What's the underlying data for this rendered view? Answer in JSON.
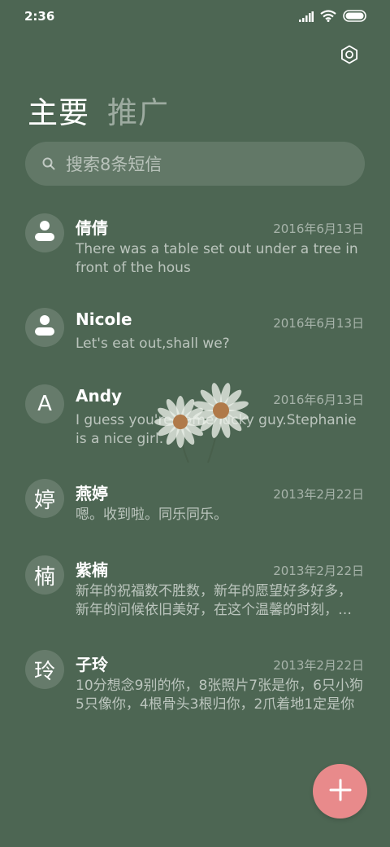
{
  "status": {
    "time": "2:36"
  },
  "tabs": [
    {
      "label": "主要"
    },
    {
      "label": "推广"
    }
  ],
  "search": {
    "placeholder": "搜索8条短信"
  },
  "messages": [
    {
      "avatar": "",
      "avatar_icon": "person-icon",
      "name": "倩倩",
      "date": "2016年6月13日",
      "preview": "There was a table set out under a tree in front of the hous"
    },
    {
      "avatar": "",
      "avatar_icon": "person-icon",
      "name": "Nicole",
      "date": "2016年6月13日",
      "preview": "Let's eat out,shall we?"
    },
    {
      "avatar": "A",
      "name": "Andy",
      "date": "2016年6月13日",
      "preview": "I guess you're some lucky guy.Stephanie is a nice girl."
    },
    {
      "avatar": "婷",
      "name": "燕婷",
      "date": "2013年2月22日",
      "preview": "嗯。收到啦。同乐同乐。"
    },
    {
      "avatar": "楠",
      "name": "紫楠",
      "date": "2013年2月22日",
      "preview": "新年的祝福数不胜数，新年的愿望好多好多，新年的问候依旧美好，在这个温馨的时刻，送上我最真诚的祝福"
    },
    {
      "avatar": "玲",
      "name": "子玲",
      "date": "2013年2月22日",
      "preview": "10分想念9别的你，8张照片7张是你，6只小狗5只像你，4根骨头3根归你，2爪着地1定是你"
    }
  ],
  "colors": {
    "background": "#4d6653",
    "fab": "#e88a8b"
  }
}
